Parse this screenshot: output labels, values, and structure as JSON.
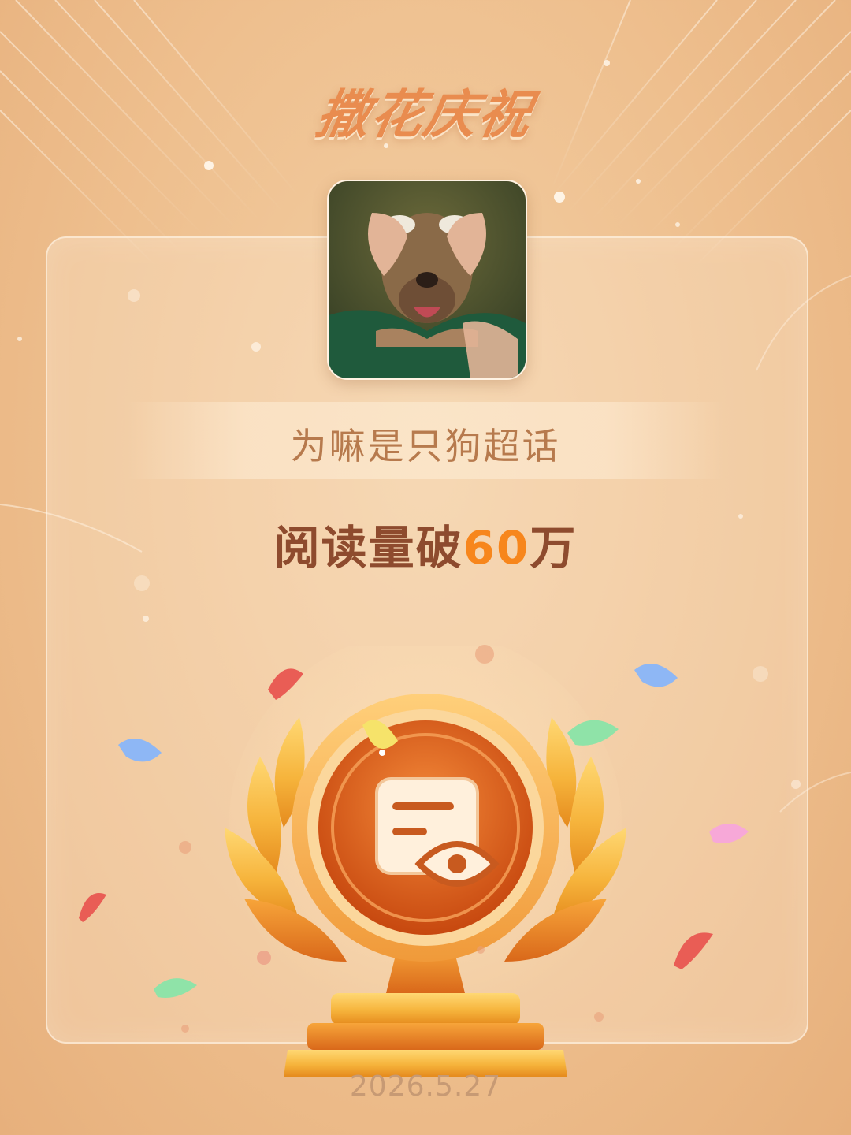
{
  "header": {
    "title": "撒花庆祝"
  },
  "topic": {
    "name": "为嘛是只狗超话"
  },
  "achievement": {
    "prefix": "阅读量破",
    "number": "60",
    "suffix": "万"
  },
  "footer": {
    "date": "2026.5.27"
  },
  "icons": {
    "avatar": "dog-avatar",
    "badge": "document-eye-icon"
  },
  "colors": {
    "background": "#eebf8e",
    "title": "#e98c4f",
    "topic_text": "#b77a4d",
    "achievement_text": "#8e4b2e",
    "achievement_number": "#f7861c",
    "trophy_gold": "#f6b43c",
    "medal_core": "#e4651e"
  }
}
